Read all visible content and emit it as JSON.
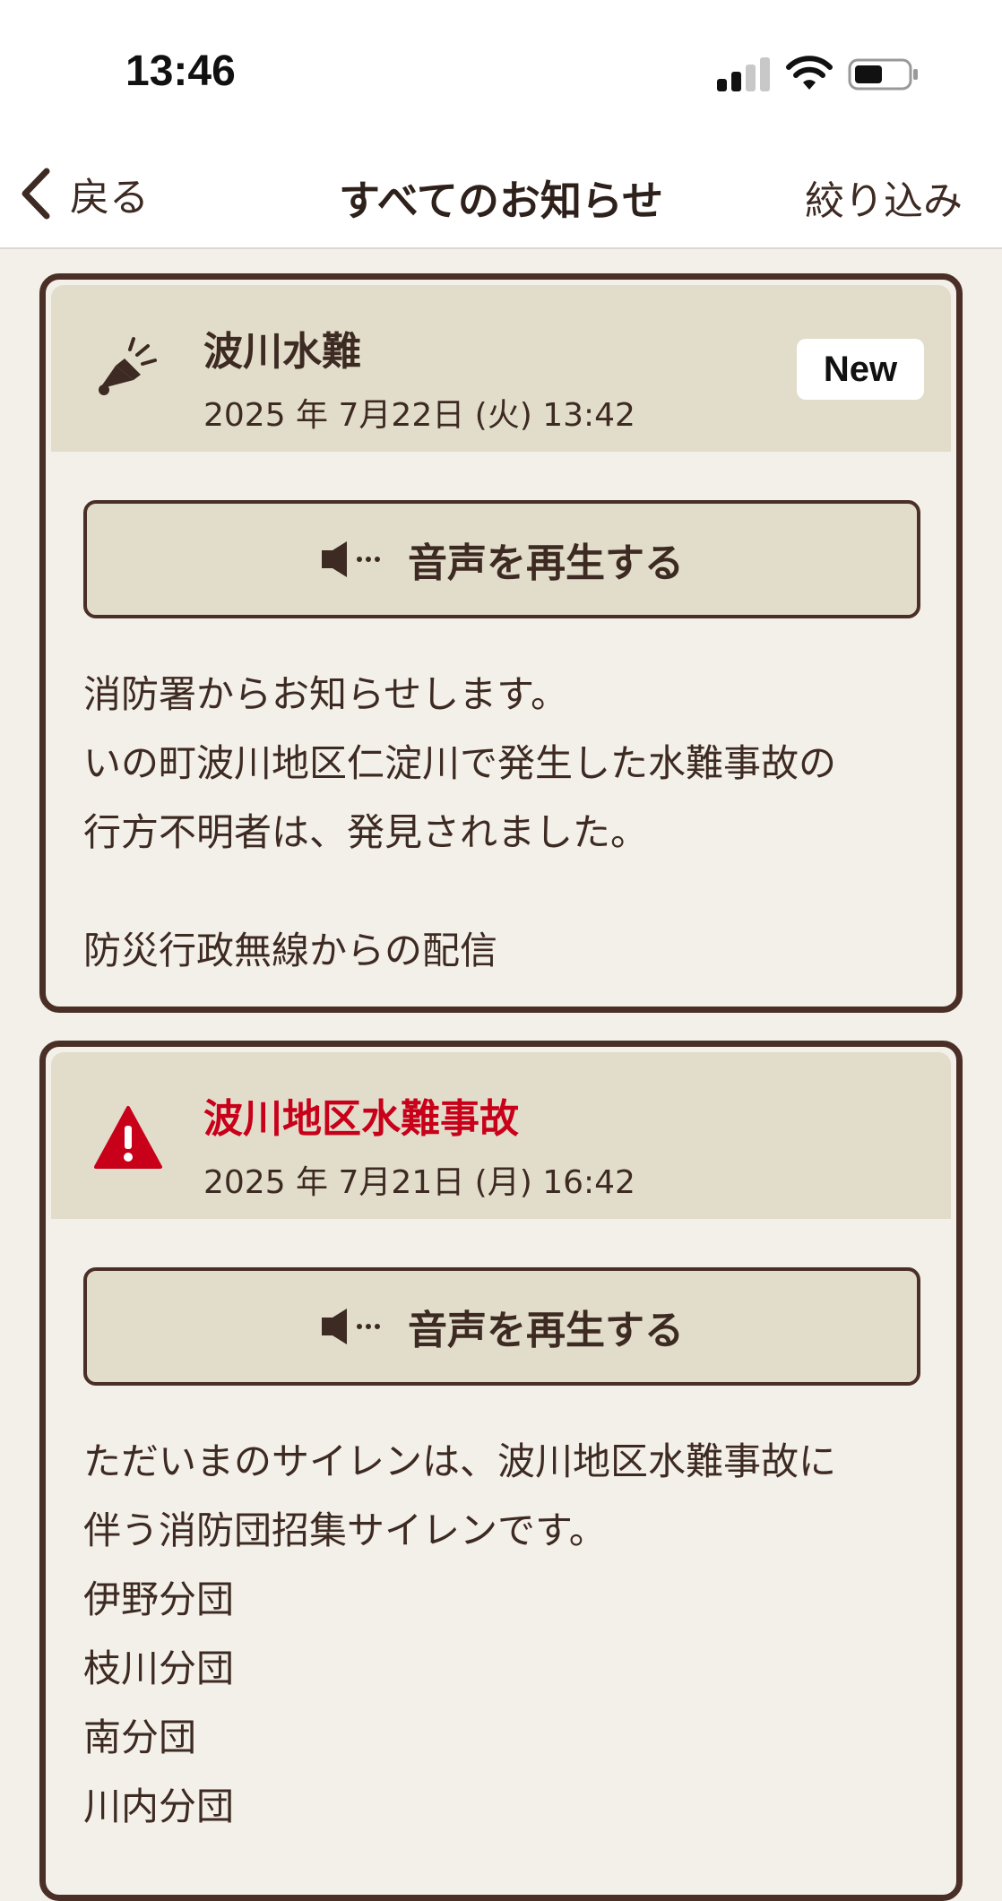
{
  "status_bar": {
    "time": "13:46"
  },
  "nav": {
    "back_label": "戻る",
    "title": "すべてのお知らせ",
    "filter_label": "絞り込み"
  },
  "notices": [
    {
      "title": "波川水難",
      "date": "2025 年 7月22日 (火) 13:42",
      "badge": "New",
      "icon": "megaphone-icon",
      "play_label": "音声を再生する",
      "lines": [
        "消防署からお知らせします。",
        "いの町波川地区仁淀川で発生した水難事故の",
        "行方不明者は、発見されました。",
        "",
        "防災行政無線からの配信"
      ]
    },
    {
      "title": "波川地区水難事故",
      "date": "2025 年 7月21日 (月) 16:42",
      "icon": "warning-icon",
      "title_color": "#c8001a",
      "play_label": "音声を再生する",
      "lines": [
        "ただいまのサイレンは、波川地区水難事故に",
        "伴う消防団招集サイレンです。",
        "伊野分団",
        "枝川分団",
        "南分団",
        "川内分団"
      ]
    }
  ]
}
